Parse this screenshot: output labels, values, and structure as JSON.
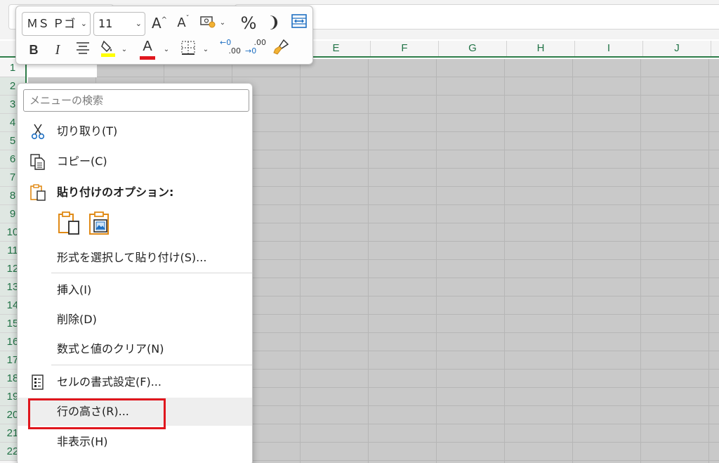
{
  "sheet": {
    "columns": [
      "E",
      "F",
      "G",
      "H",
      "I",
      "J"
    ],
    "rows": [
      "1",
      "2",
      "3",
      "4",
      "5",
      "6",
      "7",
      "8",
      "9",
      "10",
      "11",
      "12",
      "13",
      "14",
      "15",
      "16",
      "17",
      "18",
      "19",
      "20",
      "21",
      "22"
    ],
    "accent_color": "#217346",
    "selection_fill": "#c9c9c9"
  },
  "mini_toolbar": {
    "font_name": "ＭＳ Ｐゴ",
    "font_size": "11",
    "grow_font": "A",
    "shrink_font": "A",
    "percent": "%",
    "comma": "❩",
    "bold": "B",
    "italic": "I",
    "font_color_letter": "A",
    "increase_decimal_a": "←0",
    "increase_decimal_b": ".00",
    "decrease_decimal_a": ".00",
    "decrease_decimal_b": "→0",
    "fill_color": "#ffff00",
    "font_color": "#e0161d"
  },
  "context_menu": {
    "search_placeholder": "メニューの検索",
    "cut": "切り取り(T)",
    "copy": "コピー(C)",
    "paste_options": "貼り付けのオプション:",
    "paste_special": "形式を選択して貼り付け(S)...",
    "insert": "挿入(I)",
    "delete": "削除(D)",
    "clear_contents": "数式と値のクリア(N)",
    "format_cells": "セルの書式設定(F)...",
    "row_height": "行の高さ(R)...",
    "hide": "非表示(H)",
    "highlight_color": "#e0161d"
  }
}
